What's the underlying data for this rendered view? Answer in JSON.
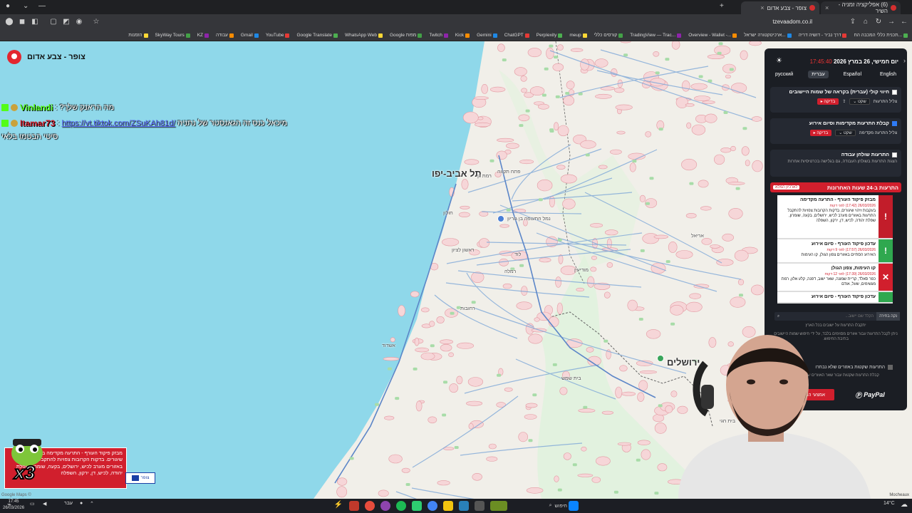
{
  "browser": {
    "tabs": [
      {
        "label": "(6) אפליקציה זמניה - השיר",
        "active": false
      },
      {
        "label": "צופר - צבע אדום",
        "active": true
      }
    ],
    "url": "tzevaadom.co.il",
    "bookmarks": [
      "תכנית כללי המכבה הח...",
      "דרך נביר - דושיה דריה",
      "ארכיטקטורה ישראל...",
      "Overview - Wallet -...",
      "TradingView — Trac...",
      "קורסים כללי",
      "meup",
      "Perplexity",
      "ChatGPT",
      "Gemini",
      "Kick",
      "Twitch",
      "Google מפות",
      "WhatsApp Web",
      "Google Translate",
      "YouTube",
      "Gmail",
      "עבודה",
      "KZ",
      "SkyWay Tours",
      "הזמנות"
    ]
  },
  "app": {
    "title": "צופר - צבע אדום"
  },
  "chat": [
    {
      "user": "Vinlandi",
      "user_color": "#53fc18",
      "message": "מה הראנק שלך?"
    },
    {
      "user": "Itamar73",
      "user_color": "#d11f2d",
      "link": "https://vt.tiktok.com/ZSuKAh81d/",
      "message": "מיכאל כנס זה הגאנסטר של נתניה"
    },
    {
      "user": "",
      "message": "סיטי הבטמו בלאי"
    }
  ],
  "map": {
    "cities": [
      {
        "name": "תל אביב-יפו",
        "size": "big"
      },
      {
        "name": "ירושלים",
        "size": "big"
      },
      {
        "name": "רמת גן",
        "size": "small"
      },
      {
        "name": "פתח תקווה",
        "size": "small"
      },
      {
        "name": "ראשון לציון",
        "size": "small"
      },
      {
        "name": "חולון",
        "size": "small"
      },
      {
        "name": "לוד",
        "size": "small"
      },
      {
        "name": "רמלה",
        "size": "small"
      },
      {
        "name": "רחובות",
        "size": "small"
      },
      {
        "name": "אשדוד",
        "size": "small"
      },
      {
        "name": "מודיעין",
        "size": "small"
      },
      {
        "name": "בית שמש",
        "size": "small"
      },
      {
        "name": "אריאל",
        "size": "small"
      },
      {
        "name": "נמל התעופה בן גוריון",
        "size": "small"
      },
      {
        "name": "בית חגי",
        "size": "small"
      }
    ],
    "copyright": "Google Maps ©",
    "credit": "Mocheaux"
  },
  "alert_widget": {
    "text": "מבזק פיקוד העורף - התרעה מקדימה בעקבות זיהוי שיגורים. בדקות הקרובות צפויות להתקבל התרעות באזורים מערב לכיש, ירושלים, בקעה, שומרון, שפלת יהודה, לכיש, דן, ירקון, השפלה",
    "multiplier": "x3",
    "mini_label": "צופר"
  },
  "panel": {
    "date": "יום חמישי, 26 במרץ 2026",
    "time": "17:45:40",
    "languages": [
      "English",
      "Español",
      "עברית",
      "русский"
    ],
    "selected_language": "עברית",
    "options": [
      {
        "title": "חיווי קולי (עברית) בקראה של שמות היישובים",
        "checked": false,
        "row_label": "צליל התרעות",
        "select": "שקט",
        "test": "בדיקה"
      },
      {
        "title": "קבלת התרעות מקדימות וסיום אירוע",
        "checked": true,
        "row_label": "צליל התרעה מקדימה",
        "select": "שקט",
        "test": "בדיקה"
      },
      {
        "title": "התרעות שולחן עבודה",
        "checked": false,
        "sub": "הצגת התרעות בשולחן העבודה, גם בגלישה בכרטיסיות אחרות"
      }
    ],
    "history_title": "התרעות ב-24 שעות האחרונות",
    "history_link": "לארכיון המלא",
    "history": [
      {
        "type": "warn",
        "title": "מבזק פיקוד העורף - התרעה מקדימה",
        "date": "26/03/2026 (17:42) לפני דקות",
        "body": "בעקבות זיהוי שיגורים, בדקות הקרובות צפויות להתקבל התרעות באזורים מערב לכיש, ירושלים, בקעה, שומרון, שפלת יהודה, לכיש, דן, ירקון, השפלה"
      },
      {
        "type": "end",
        "title": "עדכון פיקוד העורף - סיום אירוע",
        "date": "26/03/2026 (17:57) לפני 9 דקות",
        "body": "האירוע הסתיים באזורים צפון הגולן, קו העימות"
      },
      {
        "type": "rocket",
        "title": "קו העימות, צפון הגולן",
        "date": "26/03/2026 (17:39) לפני 12 דקות",
        "body": "כפר סאלד, קריית שמונה, שאר ישוב, דפנה, קלע אלון, רמת מגשימים, שעל, אודם"
      },
      {
        "type": "end",
        "title": "עדכון פיקוד העורף - סיום אירוע",
        "date": "",
        "body": ""
      }
    ],
    "search_button": "נקה בחירה",
    "search_placeholder": "הקלד שם יישוב...",
    "note1": "יתקבלו התרעות על ישובים בכל הארץ",
    "note2": "ניתן לקבל התרעות עבור אזורים מסוימים בלבד, על ידי חיפוש שמות היישובים בתיבת החיפוש.",
    "check_label": "התרעות שקטות באזורים שלא נבחרו",
    "check_sub": "קבלת התרעות שקטות עבור שאר האזורים שלא נבחרו",
    "donate": "אמצעי התרמה",
    "paypal": "PayPal"
  },
  "taskbar": {
    "search": "חיפוש",
    "time": "17:45",
    "date": "26/03/2026",
    "lang": "עבר",
    "weather": "14°C"
  }
}
